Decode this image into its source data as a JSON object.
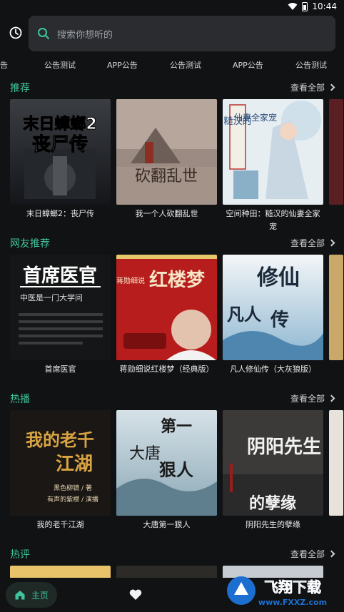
{
  "status": {
    "time": "10:44"
  },
  "search": {
    "placeholder": "搜索你想听的"
  },
  "ticker": [
    "告",
    "公告测试",
    "APP公告",
    "公告测试",
    "APP公告",
    "公告测试"
  ],
  "sections": [
    {
      "title": "推荐",
      "see_all": "查看全部",
      "books": [
        {
          "title": "末日蟑螂2：丧尸传",
          "cover_text": [
            "末日蟑螂2",
            "丧尸传"
          ]
        },
        {
          "title": "我一个人砍翻乱世",
          "cover_text": [
            "砍翻乱世"
          ]
        },
        {
          "title": "空间种田：糙汉的仙妻全家宠",
          "cover_text": [
            "仙妻全家宠",
            "糙汉的"
          ]
        }
      ]
    },
    {
      "title": "网友推荐",
      "see_all": "查看全部",
      "books": [
        {
          "title": "首席医官",
          "cover_text": [
            "首席医官",
            "中医是一门大学问"
          ]
        },
        {
          "title": "蒋勋细说红楼梦（经典版）",
          "cover_text": [
            "红楼梦",
            "蒋勋细说"
          ]
        },
        {
          "title": "凡人修仙传（大灰狼版）",
          "cover_text": [
            "修仙",
            "凡人",
            "传"
          ]
        }
      ]
    },
    {
      "title": "热播",
      "see_all": "查看全部",
      "books": [
        {
          "title": "我的老千江湖",
          "cover_text": [
            "我的老千",
            "江湖",
            "黑色柳镜 / 著",
            "有声的紫襟 / 演播"
          ]
        },
        {
          "title": "大唐第一狠人",
          "cover_text": [
            "第一",
            "狠人",
            "大唐"
          ]
        },
        {
          "title": "阴阳先生的孽缘",
          "cover_text": [
            "阴阳先生",
            "的孽缘"
          ]
        }
      ]
    },
    {
      "title": "热评",
      "see_all": "查看全部"
    }
  ],
  "bottom_nav": {
    "home_label": "主页"
  },
  "watermark": {
    "text": "飞翔下载",
    "url": "www.FXXZ.com"
  },
  "colors": {
    "accent": "#3fc59c",
    "background": "#111214",
    "search_bg": "#2a2c30"
  }
}
